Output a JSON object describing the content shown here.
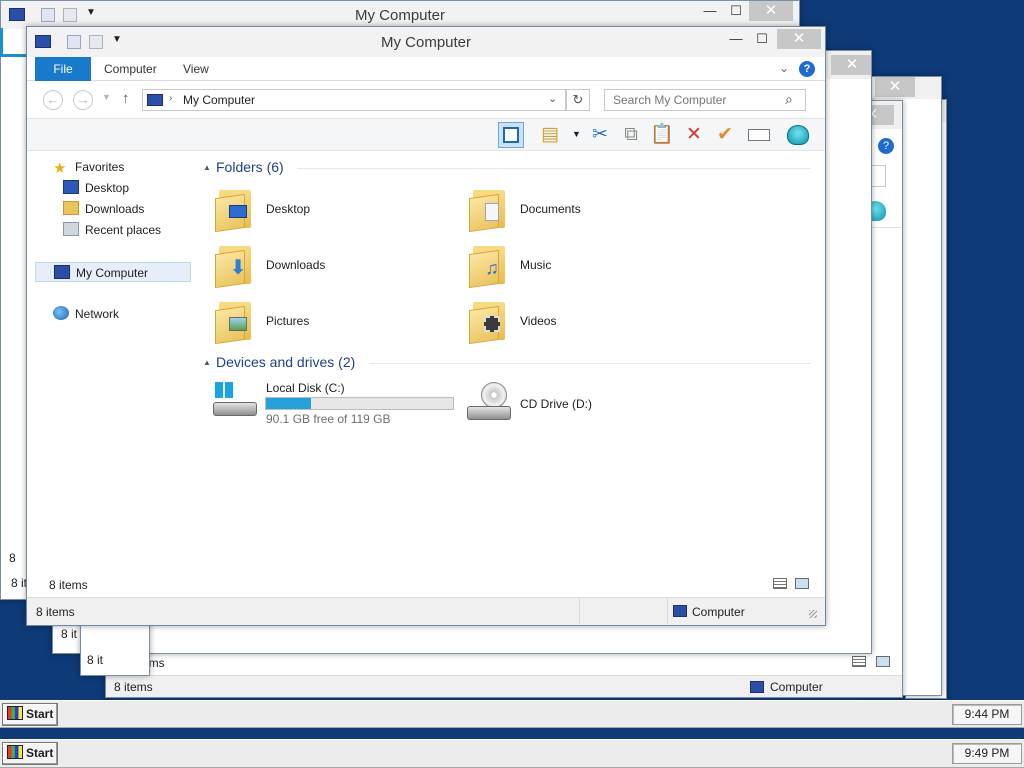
{
  "screen": {
    "desktop_color": "#0e3a78",
    "accent": "#1979ca"
  },
  "back_window": {
    "title": "My Computer",
    "status_fragments": [
      "8",
      "8 it"
    ]
  },
  "right_windows": {
    "status_items": "8 items",
    "status_location": "Computer",
    "status_fragments": [
      "8 it",
      "8 it"
    ]
  },
  "main_window": {
    "title": "My Computer",
    "tabs": {
      "file": "File",
      "computer": "Computer",
      "view": "View"
    },
    "address": {
      "location": "My Computer"
    },
    "search": {
      "placeholder": "Search My Computer"
    },
    "nav": {
      "favorites": "Favorites",
      "desktop": "Desktop",
      "downloads": "Downloads",
      "recent": "Recent places",
      "my_computer": "My Computer",
      "network": "Network"
    },
    "folders_header": "Folders (6)",
    "folders": [
      {
        "label": "Desktop"
      },
      {
        "label": "Documents"
      },
      {
        "label": "Downloads"
      },
      {
        "label": "Music"
      },
      {
        "label": "Pictures"
      },
      {
        "label": "Videos"
      }
    ],
    "devices_header": "Devices and drives (2)",
    "drives": {
      "c_name": "Local Disk (C:)",
      "c_free": "90.1 GB free of 119 GB",
      "c_used_fraction": 0.243,
      "d_name": "CD Drive (D:)"
    },
    "content_status": "8 items",
    "status_items": "8 items",
    "status_location": "Computer"
  },
  "taskbars": {
    "upper": {
      "start": "Start",
      "clock": "9:44 PM"
    },
    "lower": {
      "start": "Start",
      "clock": "9:49 PM"
    }
  }
}
